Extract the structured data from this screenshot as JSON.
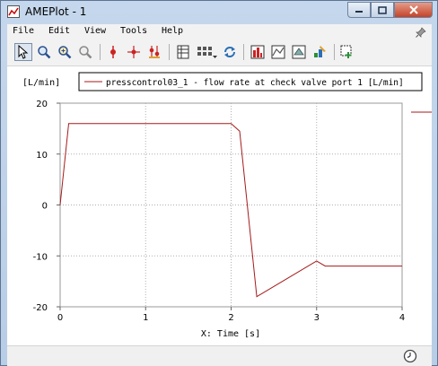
{
  "window": {
    "title": "AMEPlot - 1"
  },
  "menu": {
    "items": [
      "File",
      "Edit",
      "View",
      "Tools",
      "Help"
    ]
  },
  "toolbar": {
    "buttons": [
      "select-pointer",
      "zoom-in",
      "zoom-region",
      "zoom-reset",
      "marker-single",
      "marker-crosshair",
      "marker-multi",
      "data-table",
      "grid-layout",
      "refresh",
      "plot-bar-chart",
      "plot-xy",
      "plot-3d",
      "plot-wizard",
      "new-plot"
    ]
  },
  "plot": {
    "unit_label": "[L/min]",
    "legend_entry": "presscontrol03_1 - flow rate at check valve port 1 [L/min]",
    "xlabel": "X: Time [s]"
  },
  "colors": {
    "series": "#a51a1a",
    "grid": "#b0b0b0",
    "window_frame": "#b8cde6"
  },
  "chart_data": {
    "type": "line",
    "xlabel": "X: Time [s]",
    "ylabel": "[L/min]",
    "xlim": [
      0,
      4
    ],
    "ylim": [
      -20,
      20
    ],
    "xticks": [
      "0",
      "1",
      "2",
      "3",
      "4"
    ],
    "yticks": [
      "20",
      "10",
      "0",
      "-10",
      "-20"
    ],
    "grid": true,
    "legend_position": "top",
    "series": [
      {
        "name": "presscontrol03_1 - flow rate at check valve port 1 [L/min]",
        "x": [
          0,
          0.1,
          2.0,
          2.1,
          2.3,
          2.65,
          3.0,
          3.1,
          4.0
        ],
        "y": [
          0,
          16,
          16,
          14.5,
          -18,
          -14.5,
          -11,
          -12,
          -12
        ]
      }
    ]
  }
}
